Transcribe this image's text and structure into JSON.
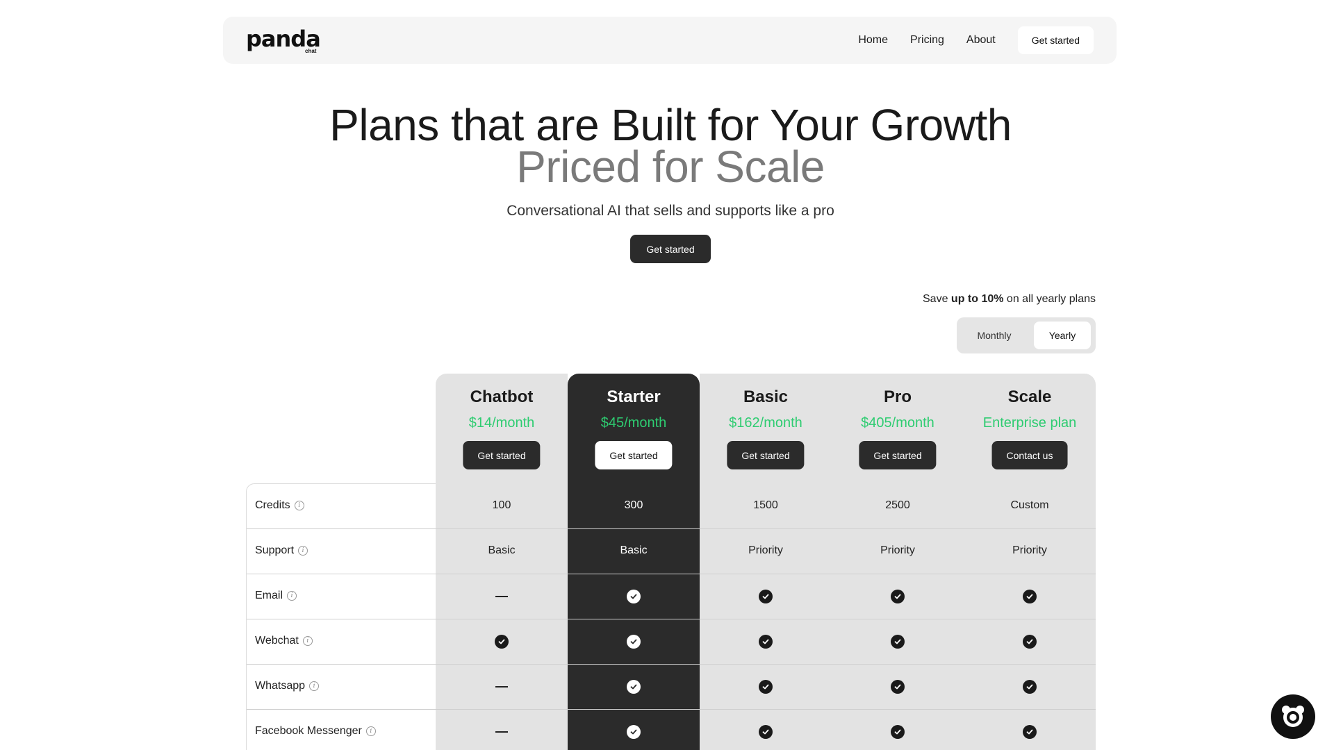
{
  "nav": {
    "logo_text": "panda",
    "logo_sub": "chat",
    "links": [
      "Home",
      "Pricing",
      "About"
    ],
    "cta": "Get started"
  },
  "hero": {
    "title_line1": "Plans that are Built for Your Growth",
    "title_line2": "Priced for Scale",
    "subtitle": "Conversational AI that sells and supports like a pro",
    "cta": "Get started"
  },
  "billing": {
    "save_prefix": "Save ",
    "save_bold": "up to 10%",
    "save_suffix": " on all yearly plans",
    "options": [
      "Monthly",
      "Yearly"
    ],
    "selected": "Yearly"
  },
  "plans": [
    {
      "name": "Chatbot",
      "price": "$14/month",
      "button": "Get started",
      "highlighted": false
    },
    {
      "name": "Starter",
      "price": "$45/month",
      "button": "Get started",
      "highlighted": true
    },
    {
      "name": "Basic",
      "price": "$162/month",
      "button": "Get started",
      "highlighted": false
    },
    {
      "name": "Pro",
      "price": "$405/month",
      "button": "Get started",
      "highlighted": false
    },
    {
      "name": "Scale",
      "price": "Enterprise plan",
      "button": "Contact us",
      "highlighted": false
    }
  ],
  "features": [
    {
      "label": "Credits",
      "values": [
        "100",
        "300",
        "1500",
        "2500",
        "Custom"
      ]
    },
    {
      "label": "Support",
      "values": [
        "Basic",
        "Basic",
        "Priority",
        "Priority",
        "Priority"
      ]
    },
    {
      "label": "Email",
      "values": [
        "dash",
        "check",
        "check",
        "check",
        "check"
      ]
    },
    {
      "label": "Webchat",
      "values": [
        "check",
        "check",
        "check",
        "check",
        "check"
      ]
    },
    {
      "label": "Whatsapp",
      "values": [
        "dash",
        "check",
        "check",
        "check",
        "check"
      ]
    },
    {
      "label": "Facebook Messenger",
      "values": [
        "dash",
        "check",
        "check",
        "check",
        "check"
      ]
    }
  ],
  "colors": {
    "price_green": "#2ecc71",
    "dark": "#2b2b2b",
    "plan_bg": "#e3e3e3"
  },
  "chat_widget": {
    "icon": "panda-chat-icon"
  }
}
